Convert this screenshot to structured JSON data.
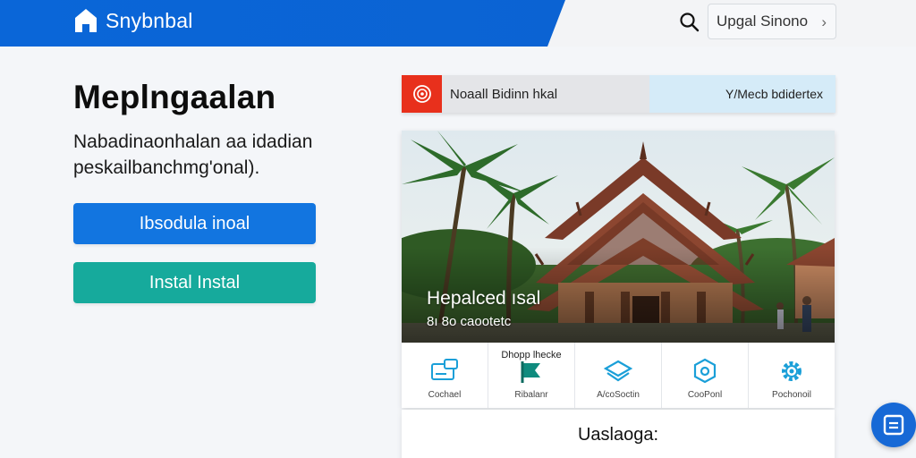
{
  "header": {
    "brand_name": "Snybnbal",
    "brand_icon": "home-icon",
    "search_icon": "search-icon",
    "language_select": {
      "value": "Upgal Sinono",
      "icon": "chevron-right-icon"
    },
    "colors": {
      "brand": "#0a66d8"
    }
  },
  "hero": {
    "title": "Meplngaalan",
    "description": "Nabadinaonhalan  aa idadian peskailbanchmg'onal).",
    "primary_button": "Ibsodula inoal",
    "secondary_button": "Instal Instal",
    "colors": {
      "primary": "#1275e0",
      "secondary": "#16aa9c"
    }
  },
  "notice": {
    "icon": "alert-circle-icon",
    "text": "Noaall Bidinn hkal",
    "link": "Y/Mecb bdidertex",
    "colors": {
      "icon_bg": "#e8301c",
      "link_bg": "#d5ebf8"
    }
  },
  "feature_card": {
    "title": "Hepalced ısal",
    "subtitle": "8ı 8o caootetc",
    "actions": [
      {
        "label": "Cochael",
        "icon": "chat-card-icon",
        "top_label": ""
      },
      {
        "label": "Ribalanr",
        "icon": "flag-icon",
        "top_label": "Dhopp lhecke"
      },
      {
        "label": "A/coSoctin",
        "icon": "layers-icon",
        "top_label": ""
      },
      {
        "label": "CooPonl",
        "icon": "target-icon",
        "top_label": ""
      },
      {
        "label": "Pochonoil",
        "icon": "settings-gear-icon",
        "top_label": ""
      }
    ]
  },
  "second_card": {
    "title": "Uaslaoga:"
  },
  "chat_fab": {
    "icon": "chat-icon"
  }
}
